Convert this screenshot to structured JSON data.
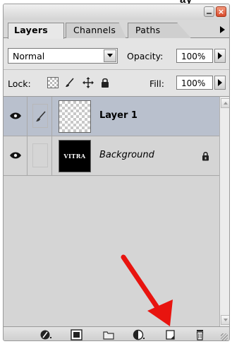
{
  "top_clip_text": "ay",
  "window": {
    "close_glyph": "×"
  },
  "tabs": [
    {
      "label": "Layers",
      "active": true
    },
    {
      "label": "Channels",
      "active": false
    },
    {
      "label": "Paths",
      "active": false
    }
  ],
  "options": {
    "blend_mode": "Normal",
    "opacity_label": "Opacity:",
    "opacity_value": "100%",
    "lock_label": "Lock:",
    "fill_label": "Fill:",
    "fill_value": "100%"
  },
  "layers": [
    {
      "name": "Layer 1",
      "visible": true,
      "selected": true,
      "thumbnail": "transparent-checker",
      "locked": false
    },
    {
      "name": "Background",
      "visible": true,
      "selected": false,
      "thumbnail": "black-with-text",
      "thumbnail_text": "VITRA",
      "locked": true
    }
  ],
  "bottom_toolbar": [
    {
      "icon": "link-layers-icon"
    },
    {
      "icon": "add-layer-style-icon"
    },
    {
      "icon": "add-layer-mask-icon"
    },
    {
      "icon": "new-group-icon"
    },
    {
      "icon": "adjustment-layer-icon"
    },
    {
      "icon": "new-layer-icon"
    },
    {
      "icon": "delete-layer-icon"
    }
  ],
  "colors": {
    "panel_bg": "#d8d8d8",
    "selected_row": "#b9c0cd",
    "annotation_arrow": "#e8140f",
    "close_button": "#d8482a"
  }
}
